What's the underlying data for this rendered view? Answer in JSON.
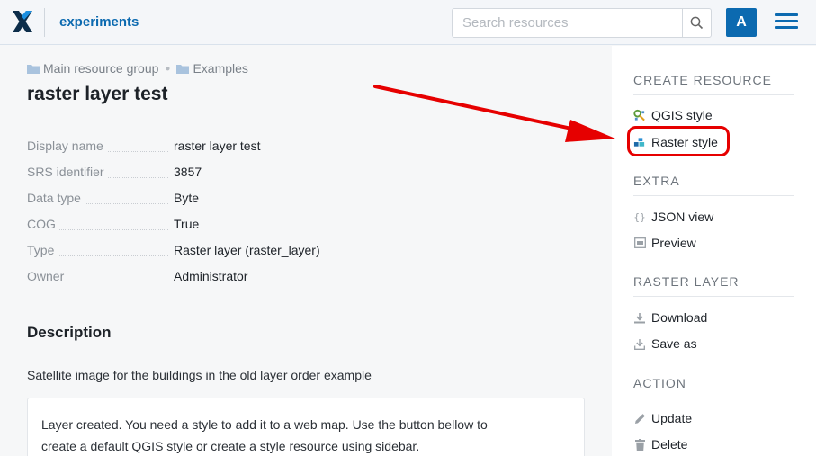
{
  "header": {
    "app_name": "experiments",
    "search_placeholder": "Search resources",
    "avatar_letter": "A"
  },
  "breadcrumb": {
    "items": [
      "Main resource group",
      "Examples"
    ]
  },
  "page": {
    "title": "raster layer test"
  },
  "properties": [
    {
      "key": "Display name",
      "value": "raster layer test"
    },
    {
      "key": "SRS identifier",
      "value": "3857"
    },
    {
      "key": "Data type",
      "value": "Byte"
    },
    {
      "key": "COG",
      "value": "True"
    },
    {
      "key": "Type",
      "value": "Raster layer (raster_layer)"
    },
    {
      "key": "Owner",
      "value": "Administrator"
    }
  ],
  "description": {
    "title": "Description",
    "text": "Satellite image for the buildings in the old layer order example"
  },
  "notice": {
    "line1": "Layer created. You need a style to add it to a web map. Use the button bellow to",
    "line2": "create a default QGIS style or create a style resource using sidebar."
  },
  "sidebar": {
    "create_title": "CREATE RESOURCE",
    "create_items": [
      "QGIS style",
      "Raster style"
    ],
    "extra_title": "EXTRA",
    "extra_items": [
      "JSON view",
      "Preview"
    ],
    "raster_title": "RASTER LAYER",
    "raster_items": [
      "Download",
      "Save as"
    ],
    "action_title": "ACTION",
    "action_items": [
      "Update",
      "Delete"
    ]
  },
  "colors": {
    "accent": "#0c6ab0",
    "annotation": "#e60000"
  }
}
